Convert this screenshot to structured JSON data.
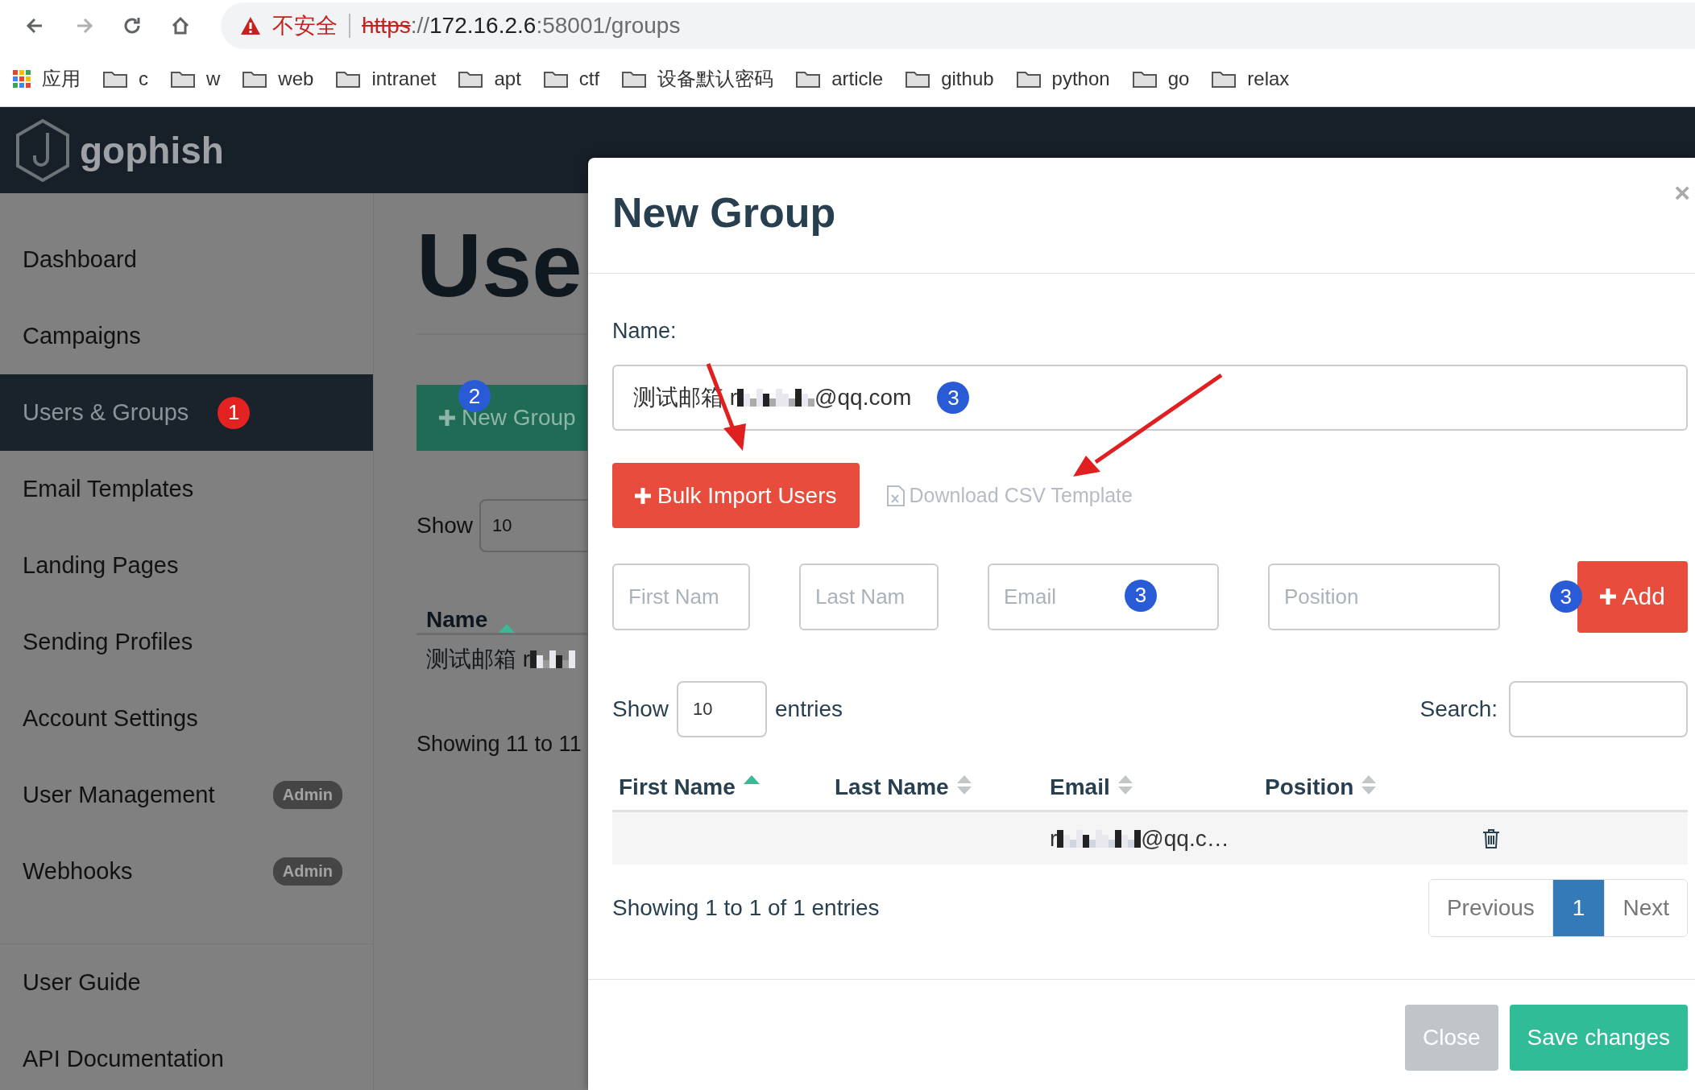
{
  "browser": {
    "nav": [
      {
        "kind": "back",
        "disabled": false
      },
      {
        "kind": "forward",
        "disabled": true
      },
      {
        "kind": "reload",
        "disabled": false
      },
      {
        "kind": "home",
        "disabled": false
      }
    ],
    "security_label": "不安全",
    "url": {
      "scheme": "https",
      "separator": "://",
      "host": "172.16.2.6",
      "rest": ":58001/groups"
    },
    "bookmarks": [
      {
        "kind": "apps",
        "label": "应用"
      },
      {
        "kind": "folder",
        "label": "c"
      },
      {
        "kind": "folder",
        "label": "w"
      },
      {
        "kind": "folder",
        "label": "web"
      },
      {
        "kind": "folder",
        "label": "intranet"
      },
      {
        "kind": "folder",
        "label": "apt"
      },
      {
        "kind": "folder",
        "label": "ctf"
      },
      {
        "kind": "folder",
        "label": "设备默认密码"
      },
      {
        "kind": "folder",
        "label": "article"
      },
      {
        "kind": "folder",
        "label": "github"
      },
      {
        "kind": "folder",
        "label": "python"
      },
      {
        "kind": "folder",
        "label": "go"
      },
      {
        "kind": "folder",
        "label": "relax"
      }
    ]
  },
  "app": {
    "brand": "gophish"
  },
  "sidebar": {
    "items": [
      {
        "label": "Dashboard",
        "selected": false
      },
      {
        "label": "Campaigns",
        "selected": false
      },
      {
        "label": "Users & Groups",
        "selected": true,
        "marker": {
          "label": "1",
          "color": "#e32222"
        }
      },
      {
        "label": "Email Templates",
        "selected": false
      },
      {
        "label": "Landing Pages",
        "selected": false
      },
      {
        "label": "Sending Profiles",
        "selected": false
      },
      {
        "label": "Account Settings",
        "selected": false
      },
      {
        "label": "User Management",
        "selected": false,
        "badge": "Admin"
      },
      {
        "label": "Webhooks",
        "selected": false,
        "badge": "Admin"
      }
    ],
    "footer_items": [
      {
        "label": "User Guide"
      },
      {
        "label": "API Documentation"
      }
    ]
  },
  "page": {
    "title": "Use",
    "new_group_button": {
      "label": "New Group",
      "marker": {
        "label": "2",
        "color": "#2a5bd7"
      }
    },
    "show_label": "Show",
    "page_length": "10",
    "columns": [
      {
        "label": "Name",
        "sorted": true
      }
    ],
    "rows": [
      {
        "name_start": "测试邮箱 r"
      }
    ],
    "info": "Showing 11 to 11"
  },
  "modal": {
    "title": "New Group",
    "close": "×",
    "name_label": "Name:",
    "name_field": {
      "value_start": "测试邮箱 r",
      "value_end": "@qq.com",
      "marker": {
        "label": "3",
        "color": "#2a5bd7"
      }
    },
    "bulk_import_button": "Bulk Import Users",
    "csv_link": "Download CSV Template",
    "fields": [
      {
        "placeholder": "First Nam"
      },
      {
        "placeholder": "Last Nam"
      },
      {
        "placeholder": "Email",
        "marker": {
          "label": "3",
          "color": "#2a5bd7"
        }
      },
      {
        "placeholder": "Position"
      }
    ],
    "add_button": {
      "label": "Add",
      "marker": {
        "label": "3",
        "color": "#2a5bd7"
      }
    },
    "show_label": "Show",
    "page_length": "10",
    "entries_label": "entries",
    "search_label": "Search:",
    "columns": [
      {
        "label": "First Name",
        "sorted": true
      },
      {
        "label": "Last Name",
        "sorted": false
      },
      {
        "label": "Email",
        "sorted": false
      },
      {
        "label": "Position",
        "sorted": false
      }
    ],
    "rows": [
      {
        "email_start": "r",
        "email_end": "@qq.c…"
      }
    ],
    "info": "Showing 1 to 1 of 1 entries",
    "pagination": [
      {
        "label": "Previous",
        "selected": false
      },
      {
        "label": "1",
        "selected": true
      },
      {
        "label": "Next",
        "selected": false
      }
    ],
    "footer_buttons": [
      {
        "label": "Close",
        "kind": "secondary"
      },
      {
        "label": "Save changes",
        "kind": "primary"
      }
    ]
  }
}
